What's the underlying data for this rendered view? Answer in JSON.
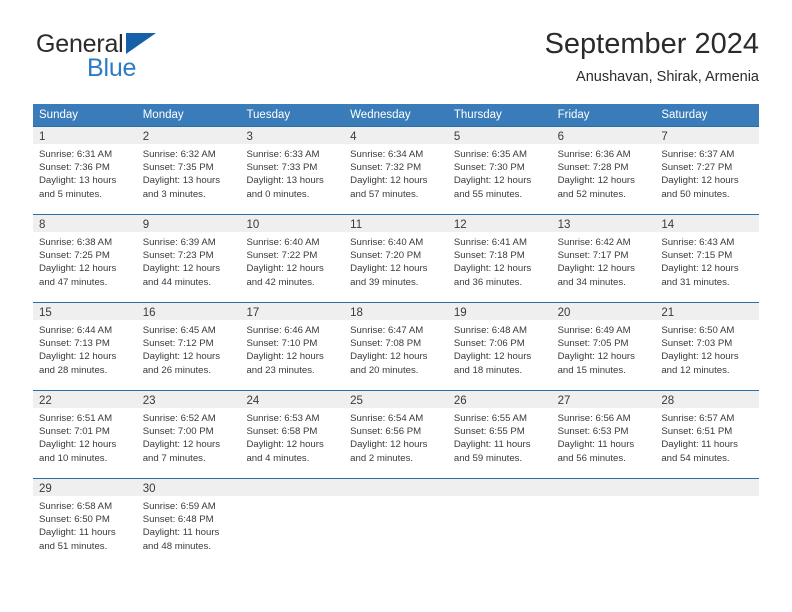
{
  "brand": {
    "name_primary": "General",
    "name_secondary": "Blue",
    "logo_icon": "blue-triangle-icon",
    "accent_color": "#2b7cc4"
  },
  "header": {
    "title": "September 2024",
    "subtitle": "Anushavan, Shirak, Armenia"
  },
  "calendar": {
    "header_color": "#3a7cba",
    "row_divider_color": "#2e6da4",
    "day_band_color": "#efefef",
    "weekdays": [
      "Sunday",
      "Monday",
      "Tuesday",
      "Wednesday",
      "Thursday",
      "Friday",
      "Saturday"
    ],
    "weeks": [
      [
        {
          "day": "1",
          "lines": [
            "Sunrise: 6:31 AM",
            "Sunset: 7:36 PM",
            "Daylight: 13 hours",
            "and 5 minutes."
          ]
        },
        {
          "day": "2",
          "lines": [
            "Sunrise: 6:32 AM",
            "Sunset: 7:35 PM",
            "Daylight: 13 hours",
            "and 3 minutes."
          ]
        },
        {
          "day": "3",
          "lines": [
            "Sunrise: 6:33 AM",
            "Sunset: 7:33 PM",
            "Daylight: 13 hours",
            "and 0 minutes."
          ]
        },
        {
          "day": "4",
          "lines": [
            "Sunrise: 6:34 AM",
            "Sunset: 7:32 PM",
            "Daylight: 12 hours",
            "and 57 minutes."
          ]
        },
        {
          "day": "5",
          "lines": [
            "Sunrise: 6:35 AM",
            "Sunset: 7:30 PM",
            "Daylight: 12 hours",
            "and 55 minutes."
          ]
        },
        {
          "day": "6",
          "lines": [
            "Sunrise: 6:36 AM",
            "Sunset: 7:28 PM",
            "Daylight: 12 hours",
            "and 52 minutes."
          ]
        },
        {
          "day": "7",
          "lines": [
            "Sunrise: 6:37 AM",
            "Sunset: 7:27 PM",
            "Daylight: 12 hours",
            "and 50 minutes."
          ]
        }
      ],
      [
        {
          "day": "8",
          "lines": [
            "Sunrise: 6:38 AM",
            "Sunset: 7:25 PM",
            "Daylight: 12 hours",
            "and 47 minutes."
          ]
        },
        {
          "day": "9",
          "lines": [
            "Sunrise: 6:39 AM",
            "Sunset: 7:23 PM",
            "Daylight: 12 hours",
            "and 44 minutes."
          ]
        },
        {
          "day": "10",
          "lines": [
            "Sunrise: 6:40 AM",
            "Sunset: 7:22 PM",
            "Daylight: 12 hours",
            "and 42 minutes."
          ]
        },
        {
          "day": "11",
          "lines": [
            "Sunrise: 6:40 AM",
            "Sunset: 7:20 PM",
            "Daylight: 12 hours",
            "and 39 minutes."
          ]
        },
        {
          "day": "12",
          "lines": [
            "Sunrise: 6:41 AM",
            "Sunset: 7:18 PM",
            "Daylight: 12 hours",
            "and 36 minutes."
          ]
        },
        {
          "day": "13",
          "lines": [
            "Sunrise: 6:42 AM",
            "Sunset: 7:17 PM",
            "Daylight: 12 hours",
            "and 34 minutes."
          ]
        },
        {
          "day": "14",
          "lines": [
            "Sunrise: 6:43 AM",
            "Sunset: 7:15 PM",
            "Daylight: 12 hours",
            "and 31 minutes."
          ]
        }
      ],
      [
        {
          "day": "15",
          "lines": [
            "Sunrise: 6:44 AM",
            "Sunset: 7:13 PM",
            "Daylight: 12 hours",
            "and 28 minutes."
          ]
        },
        {
          "day": "16",
          "lines": [
            "Sunrise: 6:45 AM",
            "Sunset: 7:12 PM",
            "Daylight: 12 hours",
            "and 26 minutes."
          ]
        },
        {
          "day": "17",
          "lines": [
            "Sunrise: 6:46 AM",
            "Sunset: 7:10 PM",
            "Daylight: 12 hours",
            "and 23 minutes."
          ]
        },
        {
          "day": "18",
          "lines": [
            "Sunrise: 6:47 AM",
            "Sunset: 7:08 PM",
            "Daylight: 12 hours",
            "and 20 minutes."
          ]
        },
        {
          "day": "19",
          "lines": [
            "Sunrise: 6:48 AM",
            "Sunset: 7:06 PM",
            "Daylight: 12 hours",
            "and 18 minutes."
          ]
        },
        {
          "day": "20",
          "lines": [
            "Sunrise: 6:49 AM",
            "Sunset: 7:05 PM",
            "Daylight: 12 hours",
            "and 15 minutes."
          ]
        },
        {
          "day": "21",
          "lines": [
            "Sunrise: 6:50 AM",
            "Sunset: 7:03 PM",
            "Daylight: 12 hours",
            "and 12 minutes."
          ]
        }
      ],
      [
        {
          "day": "22",
          "lines": [
            "Sunrise: 6:51 AM",
            "Sunset: 7:01 PM",
            "Daylight: 12 hours",
            "and 10 minutes."
          ]
        },
        {
          "day": "23",
          "lines": [
            "Sunrise: 6:52 AM",
            "Sunset: 7:00 PM",
            "Daylight: 12 hours",
            "and 7 minutes."
          ]
        },
        {
          "day": "24",
          "lines": [
            "Sunrise: 6:53 AM",
            "Sunset: 6:58 PM",
            "Daylight: 12 hours",
            "and 4 minutes."
          ]
        },
        {
          "day": "25",
          "lines": [
            "Sunrise: 6:54 AM",
            "Sunset: 6:56 PM",
            "Daylight: 12 hours",
            "and 2 minutes."
          ]
        },
        {
          "day": "26",
          "lines": [
            "Sunrise: 6:55 AM",
            "Sunset: 6:55 PM",
            "Daylight: 11 hours",
            "and 59 minutes."
          ]
        },
        {
          "day": "27",
          "lines": [
            "Sunrise: 6:56 AM",
            "Sunset: 6:53 PM",
            "Daylight: 11 hours",
            "and 56 minutes."
          ]
        },
        {
          "day": "28",
          "lines": [
            "Sunrise: 6:57 AM",
            "Sunset: 6:51 PM",
            "Daylight: 11 hours",
            "and 54 minutes."
          ]
        }
      ],
      [
        {
          "day": "29",
          "lines": [
            "Sunrise: 6:58 AM",
            "Sunset: 6:50 PM",
            "Daylight: 11 hours",
            "and 51 minutes."
          ]
        },
        {
          "day": "30",
          "lines": [
            "Sunrise: 6:59 AM",
            "Sunset: 6:48 PM",
            "Daylight: 11 hours",
            "and 48 minutes."
          ]
        },
        {
          "day": "",
          "lines": []
        },
        {
          "day": "",
          "lines": []
        },
        {
          "day": "",
          "lines": []
        },
        {
          "day": "",
          "lines": []
        },
        {
          "day": "",
          "lines": []
        }
      ]
    ]
  }
}
